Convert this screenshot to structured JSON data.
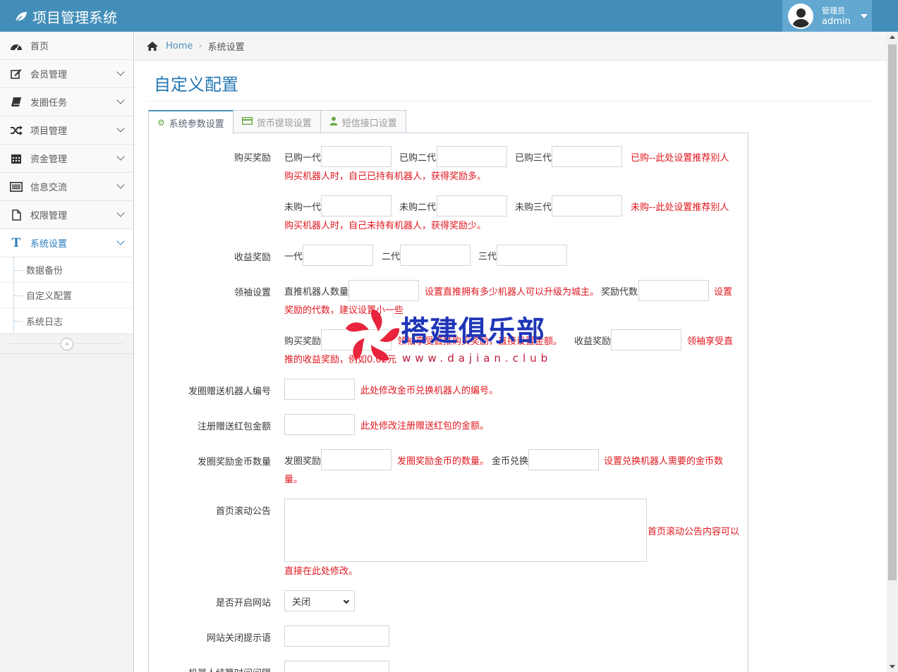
{
  "app": {
    "title": "项目管理系统"
  },
  "user": {
    "role": "管理员",
    "name": "admin"
  },
  "sidebar": {
    "items": [
      {
        "label": "首页",
        "icon": "dashboard-icon"
      },
      {
        "label": "会员管理",
        "icon": "edit-icon"
      },
      {
        "label": "发圈任务",
        "icon": "book-icon"
      },
      {
        "label": "项目管理",
        "icon": "shuffle-icon"
      },
      {
        "label": "资金管理",
        "icon": "calendar-icon"
      },
      {
        "label": "信息交流",
        "icon": "list-icon"
      },
      {
        "label": "权限管理",
        "icon": "file-icon"
      },
      {
        "label": "系统设置",
        "icon": "text-icon"
      }
    ],
    "subitems": [
      "数据备份",
      "自定义配置",
      "系统日志"
    ]
  },
  "breadcrumb": {
    "home": "Home",
    "current": "系统设置"
  },
  "page": {
    "title": "自定义配置"
  },
  "tabs": [
    "系统参数设置",
    "货币提现设置",
    "短信接口设置"
  ],
  "form": {
    "buy_reward": {
      "label": "购买奖励",
      "bought": [
        "已购一代",
        "已购二代",
        "已购三代"
      ],
      "bought_note_1": "已购--此处设置推荐别人",
      "bought_note_2": "购买机器人时，自己已持有机器人，获得奖励多。",
      "unbought": [
        "未购一代",
        "未购二代",
        "未购三代"
      ],
      "unbought_note_1": "未购--此处设置推荐别人",
      "unbought_note_2": "购买机器人时，自己未持有机器人，获得奖励少。"
    },
    "income_reward": {
      "label": "收益奖励",
      "levels": [
        "一代",
        "二代",
        "三代"
      ]
    },
    "leader": {
      "label": "领袖设置",
      "direct_count": "直推机器人数量",
      "direct_note": "设置直推拥有多少机器人可以升级为城主。",
      "reward_gen": "奖励代数",
      "reward_gen_note_1": "设置",
      "reward_gen_note_2": "奖励的代数，建议设置小一些",
      "buy_reward": "购买奖励",
      "buy_reward_note": "领袖享受直推购买奖励，直接设置金额。",
      "income_reward": "收益奖励",
      "income_note_1": "领袖享受直",
      "income_note_2": "推的收益奖励，例如0.02元"
    },
    "gift_robot": {
      "label": "发圈赠送机器人编号",
      "note": "此处修改金币兑换机器人的编号。"
    },
    "register_gift": {
      "label": "注册赠送红包金额",
      "note": "此处修改注册赠送红包的金额。"
    },
    "circle_coins": {
      "label": "发圈奖励金币数量",
      "reward": "发圈奖励",
      "reward_note": "发圈奖励金币的数量。",
      "exchange": "金币兑换",
      "exchange_note_1": "设置兑换机器人需要的金币数",
      "exchange_note_2": "量。"
    },
    "notice": {
      "label": "首页滚动公告",
      "note_1": "首页滚动公告内容可以",
      "note_2": "直接在此处修改。"
    },
    "site_open": {
      "label": "是否开启网站",
      "value": "关闭"
    },
    "close_tip": {
      "label": "网站关闭提示语"
    },
    "settle": {
      "label": "机器人结算时间间隔"
    }
  },
  "watermark": {
    "text": "搭建俱乐部",
    "url": "www.dajian.club"
  }
}
